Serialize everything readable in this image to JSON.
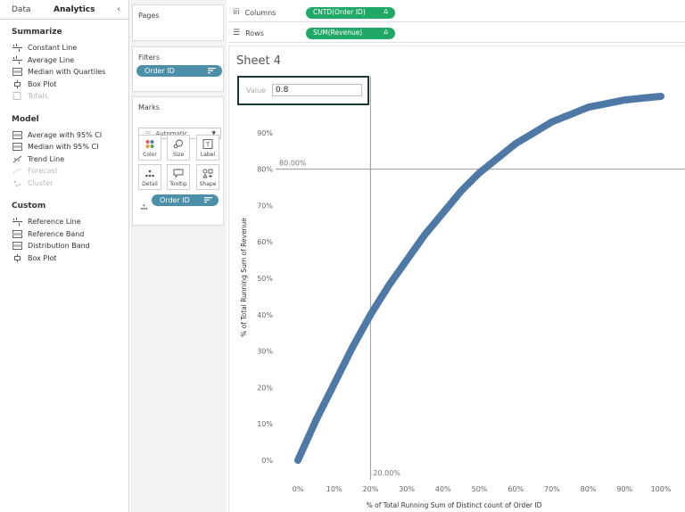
{
  "left_pane": {
    "tabs": [
      {
        "label": "Data"
      },
      {
        "label": "Analytics"
      }
    ],
    "collapse_glyph": "‹",
    "sections": [
      {
        "title": "Summarize",
        "items": [
          {
            "label": "Constant Line",
            "icon": "line-icon",
            "enabled": true
          },
          {
            "label": "Average Line",
            "icon": "line-icon",
            "enabled": true
          },
          {
            "label": "Median with Quartiles",
            "icon": "band-icon",
            "enabled": true
          },
          {
            "label": "Box Plot",
            "icon": "boxplot-icon",
            "enabled": true
          },
          {
            "label": "Totals",
            "icon": "totals-icon",
            "enabled": false
          }
        ]
      },
      {
        "title": "Model",
        "items": [
          {
            "label": "Average with 95% CI",
            "icon": "band-icon",
            "enabled": true
          },
          {
            "label": "Median with 95% CI",
            "icon": "band-icon",
            "enabled": true
          },
          {
            "label": "Trend Line",
            "icon": "trend-icon",
            "enabled": true
          },
          {
            "label": "Forecast",
            "icon": "forecast-icon",
            "enabled": false
          },
          {
            "label": "Cluster",
            "icon": "cluster-icon",
            "enabled": false
          }
        ]
      },
      {
        "title": "Custom",
        "items": [
          {
            "label": "Reference Line",
            "icon": "line-icon",
            "enabled": true
          },
          {
            "label": "Reference Band",
            "icon": "band-icon",
            "enabled": true
          },
          {
            "label": "Distribution Band",
            "icon": "band-icon",
            "enabled": true
          },
          {
            "label": "Box Plot",
            "icon": "boxplot-icon",
            "enabled": true
          }
        ]
      }
    ]
  },
  "cards": {
    "pages": {
      "title": "Pages"
    },
    "filters": {
      "title": "Filters",
      "pill": "Order ID"
    },
    "marks": {
      "title": "Marks",
      "mark_type": "Automatic",
      "buttons": [
        {
          "label": "Color",
          "icon": "color-icon"
        },
        {
          "label": "Size",
          "icon": "size-icon"
        },
        {
          "label": "Label",
          "icon": "label-icon"
        },
        {
          "label": "Detail",
          "icon": "detail-icon"
        },
        {
          "label": "Tooltip",
          "icon": "tooltip-icon"
        },
        {
          "label": "Shape",
          "icon": "shape-icon"
        }
      ],
      "detail_pill": "Order ID"
    }
  },
  "shelves": {
    "columns": {
      "label": "Columns",
      "pill": "CNTD(Order ID)",
      "delta": "Δ"
    },
    "rows": {
      "label": "Rows",
      "pill": "SUM(Revenue)",
      "delta": "Δ"
    }
  },
  "sheet": {
    "title": "Sheet 4",
    "value_label": "Value",
    "value_input": "0.8"
  },
  "colors": {
    "accent_pill": "#4b8fa8",
    "green_pill": "#1fa866",
    "curve": "#4e79a7"
  },
  "chart_data": {
    "type": "line",
    "title": "",
    "xlabel": "% of Total Running Sum of Distinct count of Order ID",
    "ylabel": "% of Total Running Sum of Revenue",
    "xlim": [
      0,
      1
    ],
    "ylim": [
      0,
      1
    ],
    "x_ticks": [
      {
        "v": 0,
        "label": "0%"
      },
      {
        "v": 0.1,
        "label": "10%"
      },
      {
        "v": 0.2,
        "label": "20%"
      },
      {
        "v": 0.3,
        "label": "30%"
      },
      {
        "v": 0.4,
        "label": "40%"
      },
      {
        "v": 0.5,
        "label": "50%"
      },
      {
        "v": 0.6,
        "label": "60%"
      },
      {
        "v": 0.7,
        "label": "70%"
      },
      {
        "v": 0.8,
        "label": "80%"
      },
      {
        "v": 0.9,
        "label": "90%"
      },
      {
        "v": 1.0,
        "label": "100%"
      }
    ],
    "y_ticks": [
      {
        "v": 0,
        "label": "0%"
      },
      {
        "v": 0.1,
        "label": "10%"
      },
      {
        "v": 0.2,
        "label": "20%"
      },
      {
        "v": 0.3,
        "label": "30%"
      },
      {
        "v": 0.4,
        "label": "40%"
      },
      {
        "v": 0.5,
        "label": "50%"
      },
      {
        "v": 0.6,
        "label": "60%"
      },
      {
        "v": 0.7,
        "label": "70%"
      },
      {
        "v": 0.8,
        "label": "80%"
      },
      {
        "v": 0.9,
        "label": "90%"
      }
    ],
    "reference_lines": [
      {
        "axis": "y",
        "value": 0.8,
        "label": "80.00%"
      },
      {
        "axis": "x",
        "value": 0.2,
        "label": "20.00%"
      }
    ],
    "series": [
      {
        "x": [
          0,
          0.05,
          0.1,
          0.15,
          0.2,
          0.25,
          0.3,
          0.35,
          0.4,
          0.45,
          0.5,
          0.55,
          0.6,
          0.65,
          0.7,
          0.75,
          0.8,
          0.85,
          0.9,
          0.95,
          1.0
        ],
        "y": [
          0,
          0.11,
          0.21,
          0.31,
          0.4,
          0.48,
          0.55,
          0.62,
          0.68,
          0.74,
          0.79,
          0.83,
          0.87,
          0.9,
          0.93,
          0.95,
          0.97,
          0.98,
          0.99,
          0.995,
          1.0
        ]
      }
    ],
    "grid": false
  }
}
